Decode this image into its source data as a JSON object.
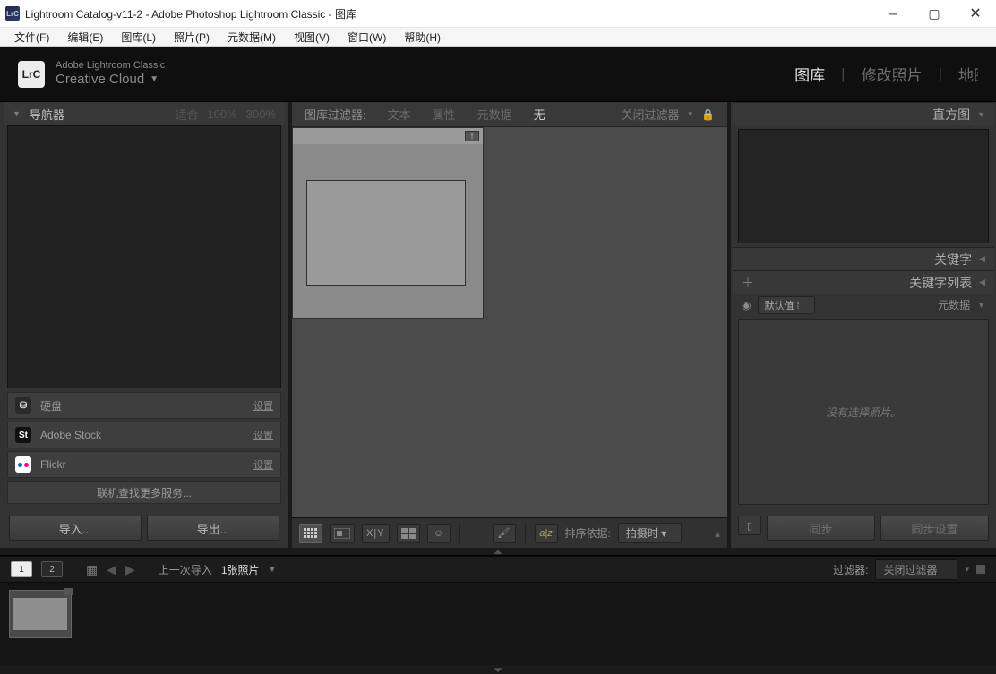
{
  "titlebar": {
    "app_name": "LrC",
    "title": "Lightroom Catalog-v11-2 - Adobe Photoshop Lightroom Classic - 图库"
  },
  "menubar": {
    "items": [
      "文件(F)",
      "编辑(E)",
      "图库(L)",
      "照片(P)",
      "元数据(M)",
      "视图(V)",
      "窗口(W)",
      "帮助(H)"
    ]
  },
  "topbar": {
    "brand_line1": "Adobe Lightroom Classic",
    "brand_line2": "Creative Cloud",
    "modules": {
      "library": "图库",
      "develop": "修改照片",
      "map": "地图"
    }
  },
  "left": {
    "navigator": {
      "title": "导航器",
      "fit": "适合",
      "p100": "100%",
      "p300": "300%"
    },
    "services": {
      "hd": "硬盘",
      "stock": "Adobe Stock",
      "flickr": "Flickr",
      "setup": "设置",
      "more": "联机查找更多服务..."
    },
    "actions": {
      "import": "导入...",
      "export": "导出..."
    }
  },
  "filterbar": {
    "label": "图库过滤器:",
    "text": "文本",
    "attr": "属性",
    "meta": "元数据",
    "none": "无",
    "close": "关闭过滤器"
  },
  "center_toolbar": {
    "sort_label": "排序依据:",
    "sort_value": "拍摄时"
  },
  "right": {
    "histogram": "直方图",
    "keywording": "关键字",
    "keyword_list": "关键字列表",
    "metadata_header": "元数据",
    "preset": "默认值",
    "no_select": "没有选择照片。",
    "sync": "同步",
    "sync_settings": "同步设置"
  },
  "footer": {
    "last_import": "上一次导入",
    "count": "1张照片",
    "filter_label": "过滤器:",
    "filter_value": "关闭过滤器"
  }
}
